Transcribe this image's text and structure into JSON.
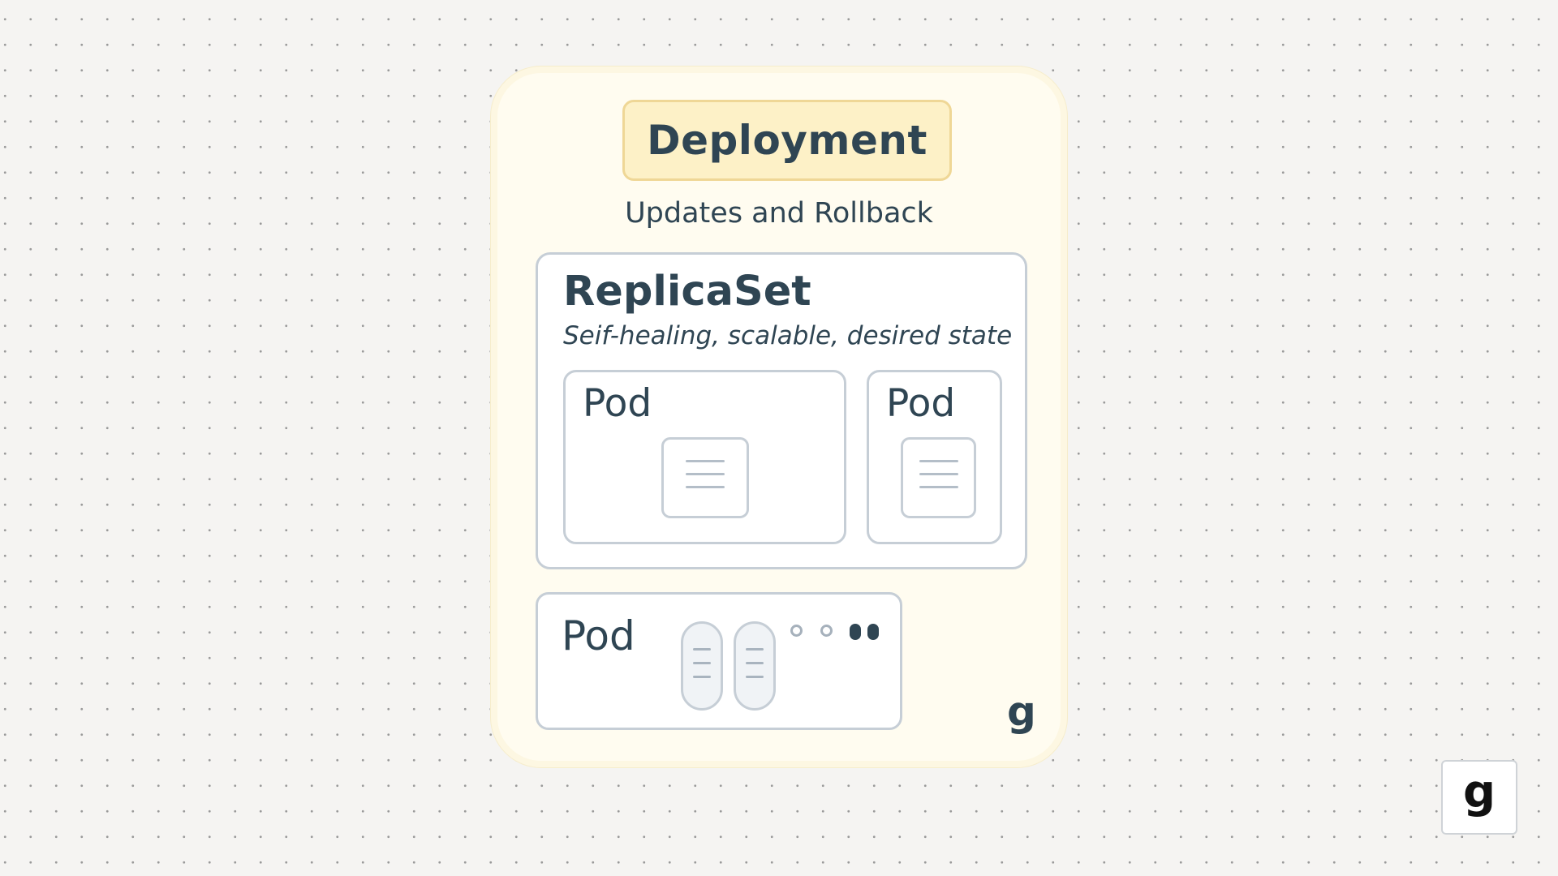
{
  "deployment": {
    "title": "Deployment",
    "subtitle": "Updates and Rollback"
  },
  "replicaset": {
    "title": "ReplicaSet",
    "subtitle": "Seif-healing, scalable, desired state",
    "pods": [
      {
        "label": "Pod"
      },
      {
        "label": "Pod"
      }
    ]
  },
  "standalone_pod": {
    "label": "Pod",
    "status_indicators": [
      "empty-circle",
      "empty-circle",
      "filled-pill",
      "filled-pill"
    ]
  },
  "logo": {
    "card_mark": "g",
    "corner_mark": "g"
  },
  "colors": {
    "ink": "#2f4553",
    "deployment_fill": "#fdf1c7",
    "deployment_border": "#efd796",
    "card_background": "#fffcf0",
    "box_border": "#c6ced6",
    "page_background": "#f5f4f2"
  }
}
